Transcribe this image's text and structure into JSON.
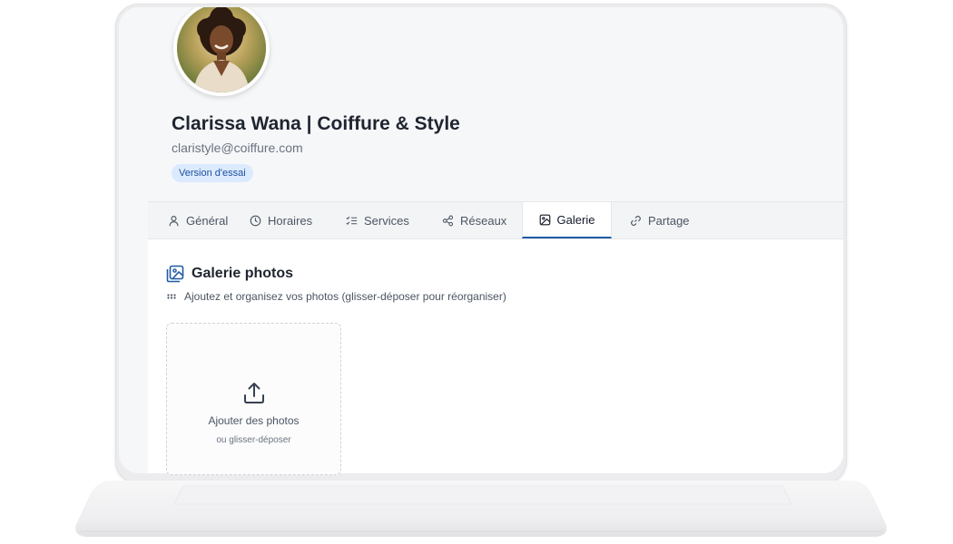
{
  "profile": {
    "name": "Clarissa Wana | Coiffure & Style",
    "email": "claristyle@coiffure.com",
    "badge": "Version d'essai"
  },
  "tabs": [
    {
      "label": "Général",
      "icon": "user-icon"
    },
    {
      "label": "Horaires",
      "icon": "clock-icon"
    },
    {
      "label": "Services",
      "icon": "list-checks-icon"
    },
    {
      "label": "Réseaux",
      "icon": "share-icon"
    },
    {
      "label": "Galerie",
      "icon": "image-icon",
      "active": true
    },
    {
      "label": "Partage",
      "icon": "link-icon"
    }
  ],
  "gallery": {
    "title": "Galerie photos",
    "subtitle": "Ajoutez et organisez vos photos (glisser-déposer pour réorganiser)",
    "upload_label": "Ajouter des photos",
    "upload_hint": "ou glisser-déposer"
  },
  "colors": {
    "accent": "#1f5aa6",
    "badge_bg": "#dbeafe",
    "badge_text": "#1e4f9c"
  }
}
